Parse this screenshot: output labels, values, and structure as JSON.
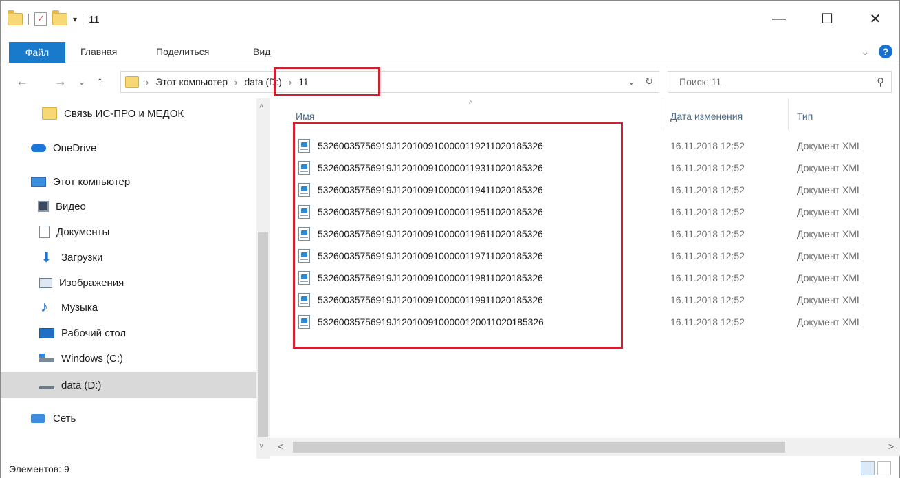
{
  "window": {
    "title": "11",
    "qat_dropdown": "▾",
    "controls": {
      "minimize": "—",
      "maximize": "☐",
      "close": "✕"
    }
  },
  "ribbon": {
    "file_tab": "Файл",
    "tabs": [
      "Главная",
      "Поделиться",
      "Вид"
    ],
    "expand": "⌄",
    "help": "?"
  },
  "nav": {
    "back": "←",
    "forward": "→",
    "recent": "⌄",
    "up": "↑"
  },
  "address": {
    "crumbs": [
      "Этот компьютер",
      "data (D:)",
      "11"
    ],
    "separator": "›",
    "dropdown": "⌄",
    "refresh": "↻"
  },
  "search": {
    "placeholder": "Поиск: 11",
    "icon": "⚲"
  },
  "sidebar": {
    "items": [
      {
        "label": "Связь ИС-ПРО и МЕДОК",
        "icon": "folder-icon"
      },
      {
        "label": "OneDrive",
        "icon": "cloud-icon"
      },
      {
        "label": "Этот компьютер",
        "icon": "computer-icon"
      },
      {
        "label": "Видео",
        "icon": "video-icon"
      },
      {
        "label": "Документы",
        "icon": "documents-icon"
      },
      {
        "label": "Загрузки",
        "icon": "downloads-icon"
      },
      {
        "label": "Изображения",
        "icon": "pictures-icon"
      },
      {
        "label": "Музыка",
        "icon": "music-icon"
      },
      {
        "label": "Рабочий стол",
        "icon": "desktop-icon"
      },
      {
        "label": "Windows (C:)",
        "icon": "windows-drive-icon"
      },
      {
        "label": "data (D:)",
        "icon": "drive-icon",
        "selected": true
      },
      {
        "label": "Сеть",
        "icon": "network-icon"
      }
    ]
  },
  "columns": {
    "name": "Имя",
    "date": "Дата изменения",
    "type": "Тип",
    "sort_indicator": "^"
  },
  "files": [
    {
      "name": "53260035756919J1201009100000119211020185326",
      "date": "16.11.2018 12:52",
      "type": "Документ XML"
    },
    {
      "name": "53260035756919J1201009100000119311020185326",
      "date": "16.11.2018 12:52",
      "type": "Документ XML"
    },
    {
      "name": "53260035756919J1201009100000119411020185326",
      "date": "16.11.2018 12:52",
      "type": "Документ XML"
    },
    {
      "name": "53260035756919J1201009100000119511020185326",
      "date": "16.11.2018 12:52",
      "type": "Документ XML"
    },
    {
      "name": "53260035756919J1201009100000119611020185326",
      "date": "16.11.2018 12:52",
      "type": "Документ XML"
    },
    {
      "name": "53260035756919J1201009100000119711020185326",
      "date": "16.11.2018 12:52",
      "type": "Документ XML"
    },
    {
      "name": "53260035756919J1201009100000119811020185326",
      "date": "16.11.2018 12:52",
      "type": "Документ XML"
    },
    {
      "name": "53260035756919J1201009100000119911020185326",
      "date": "16.11.2018 12:52",
      "type": "Документ XML"
    },
    {
      "name": "53260035756919J1201009100000120011020185326",
      "date": "16.11.2018 12:52",
      "type": "Документ XML"
    }
  ],
  "scrollbars": {
    "up": "˄",
    "down": "˅",
    "left": "<",
    "right": ">"
  },
  "status": {
    "items_count": "Элементов: 9"
  },
  "colors": {
    "accent": "#1979ca",
    "highlight": "#d0202f",
    "selected_bg": "#d9d9d9"
  }
}
